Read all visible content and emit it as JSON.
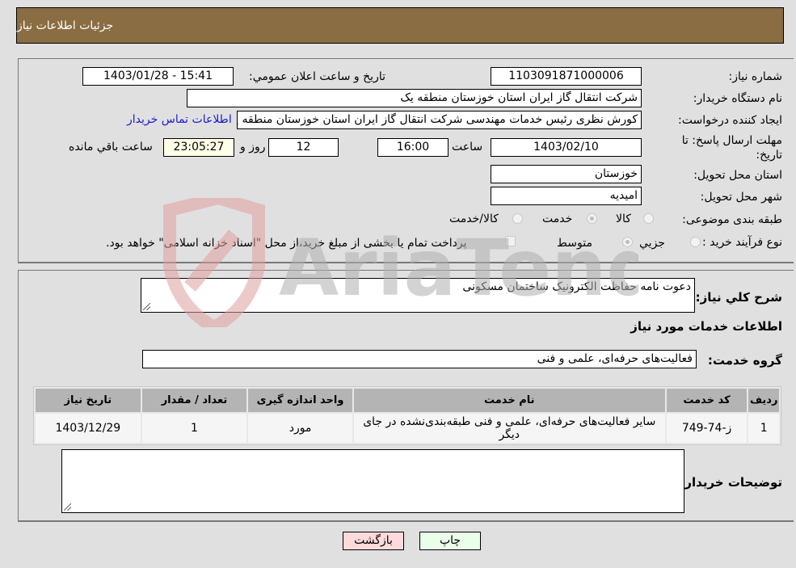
{
  "header": {
    "title": "جزئيات اطلاعات نياز"
  },
  "details": {
    "need_number": {
      "label": "شماره نياز:",
      "value": "1103091871000006"
    },
    "announce_datetime": {
      "label": "تاريخ و ساعت اعلان عمومي:",
      "value": "1403/01/28 - 15:41"
    },
    "buyer_org": {
      "label": "نام دستگاه خريدار:",
      "value": "شرکت انتقال گاز ایران  استان خوزستان منطقه یک"
    },
    "requester": {
      "label": "ايجاد کننده درخواست:",
      "value": "کورش نظری رئیس خدمات مهندسی شرکت انتقال گاز ایران  استان خوزستان منطقه یک",
      "contact_link": "اطلاعات تماس خريدار"
    },
    "deadline": {
      "label": "مهلت ارسال پاسخ: تا تاريخ:",
      "date": "1403/02/10",
      "time_label": "ساعت",
      "time": "16:00",
      "days": "12",
      "days_label": "روز و",
      "remaining": "23:05:27",
      "remaining_label": "ساعت باقي مانده"
    },
    "delivery_province": {
      "label": "استان محل تحويل:",
      "value": "خوزستان"
    },
    "delivery_city": {
      "label": "شهر محل تحويل:",
      "value": "امیدیه"
    },
    "category": {
      "label": "طبقه بندی موضوعی:",
      "options": [
        {
          "label": "کالا",
          "checked": false
        },
        {
          "label": "خدمت",
          "checked": true
        },
        {
          "label": "کالا/خدمت",
          "checked": false
        }
      ]
    },
    "purchase_type": {
      "label": "نوع فرآيند خريد :",
      "options": [
        {
          "label": "جزيي",
          "checked": false
        },
        {
          "label": "متوسط",
          "checked": true
        }
      ],
      "treasury_note": "پرداخت تمام يا بخشی از مبلغ خريد،از محل \"اسناد خزانه اسلامی\" خواهد بود."
    }
  },
  "description": {
    "label": "شرح کلي نياز:",
    "value": "دعوت نامه حفاظت الکترونیک ساختمان مسکونی"
  },
  "services": {
    "section_title": "اطلاعات خدمات مورد نياز",
    "group_label": "گروه خدمت:",
    "group_value": "فعالیت‌های حرفه‌ای، علمی و فنی",
    "columns": [
      "رديف",
      "کد خدمت",
      "نام خدمت",
      "واحد اندازه گيری",
      "تعداد / مقدار",
      "تاريخ نياز"
    ],
    "rows": [
      [
        "1",
        "ز-74-749",
        "سایر فعالیت‌های حرفه‌ای، علمی و فنی طبقه‌بندی‌نشده در جای دیگر",
        "مورد",
        "1",
        "1403/12/29"
      ]
    ]
  },
  "buyer_notes": {
    "label": "توضيحات خريدار:",
    "value": ""
  },
  "buttons": {
    "print": "چاپ",
    "back": "بازگشت"
  },
  "watermark": {
    "text": "AriaTender.neT"
  }
}
